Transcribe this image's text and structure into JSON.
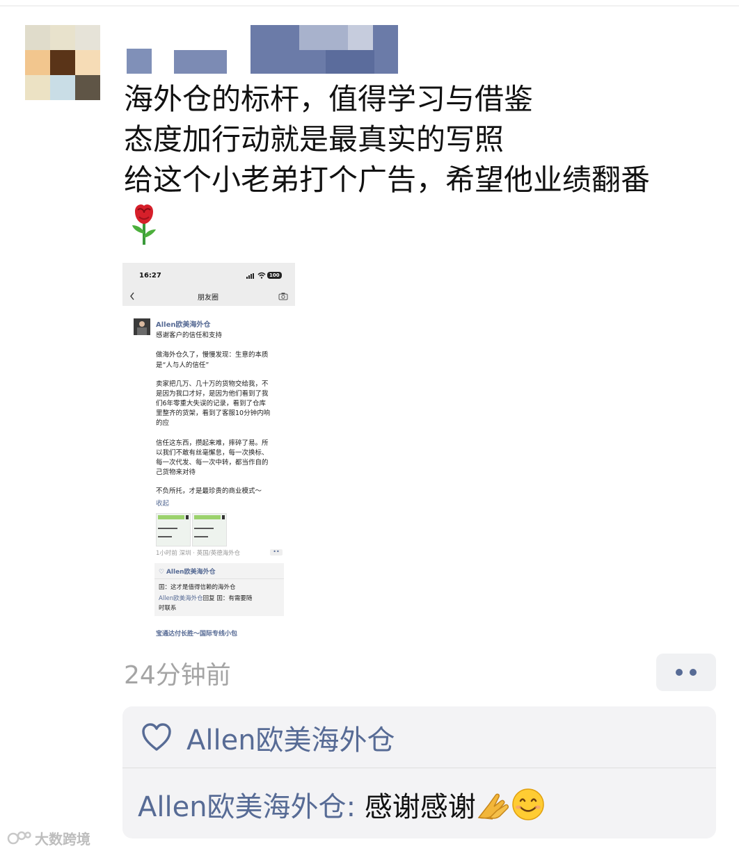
{
  "post": {
    "author_nickname": "",
    "lines": [
      "海外仓的标杆，值得学习与借鉴",
      "态度加行动就是最真实的写照",
      "给这个小老弟打个广告，希望他业绩翻番"
    ],
    "emoji": "rose",
    "time": "24分钟前"
  },
  "screenshot": {
    "status_time": "16:27",
    "battery": "100",
    "title": "朋友圈",
    "author": "Allen欧美海外仓",
    "body_lines": [
      "感谢客户的信任和支持",
      "",
      "做海外仓久了，慢慢发现：生意的本质",
      "是“人与人的信任”",
      "",
      "卖家把几万、几十万的货物交给我，不",
      "是因为我口才好，是因为他们看到了我",
      "们6年零重大失误的记录，看到了仓库",
      "里整齐的货架，看到了客服10分钟内响",
      "的应",
      "",
      "信任这东西，攒起来难，摔碎了易。所",
      "以我们不敢有丝毫懈怠，每一次换标、",
      "每一次代发、每一次中转，都当作自的",
      "己货物来对待",
      "",
      "不负所托，才是最珍贵的商业模式～"
    ],
    "collapse": "收起",
    "meta": "1小时前   深圳 · 英国/英德海外仓",
    "like": "Allen欧美海外仓",
    "comment1": "囯：这才是值得信赖的海外仓",
    "comment2_name": "Allen欧美海外仓",
    "comment2_reply": "回复",
    "comment2_text": "囯：有需要随",
    "comment2_text2": "时联系",
    "next_author": "宝通达付长胜～国际专线小包"
  },
  "likes": {
    "names": "Allen欧美海外仓"
  },
  "comment": {
    "name": "Allen欧美海外仓",
    "separator": ": ",
    "text": "感谢感谢"
  },
  "watermark": "大数跨境",
  "colors": {
    "link": "#576b95",
    "time": "#a5a5a5",
    "panel": "#f3f3f5"
  },
  "icons": [
    "heart-icon",
    "more-dots-icon",
    "rose-emoji",
    "pray-hands-emoji",
    "smile-emoji",
    "back-chevron-icon",
    "camera-icon"
  ]
}
